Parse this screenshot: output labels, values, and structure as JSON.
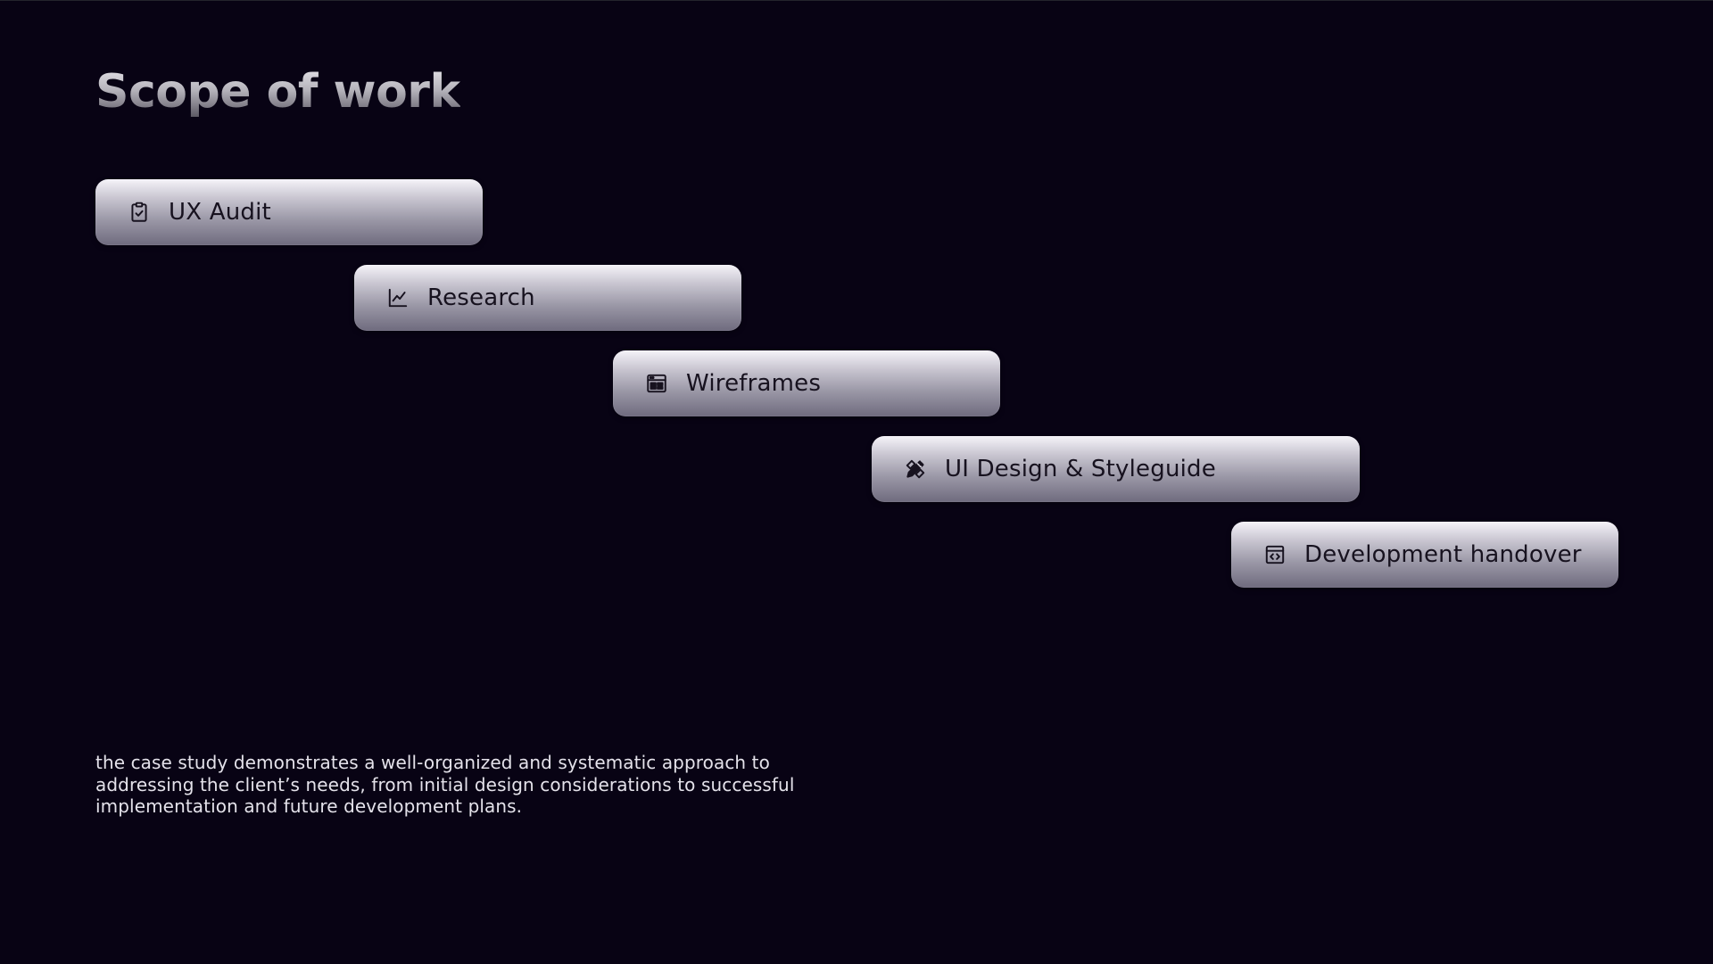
{
  "page": {
    "title": "Scope of work",
    "description": "the case study demonstrates a well-organized and systematic approach to addressing the client’s needs, from initial design considerations to successful implementation and future development plans."
  },
  "steps": [
    {
      "label": "UX Audit",
      "icon": "clipboard-check-icon"
    },
    {
      "label": "Research",
      "icon": "line-chart-icon"
    },
    {
      "label": "Wireframes",
      "icon": "layout-window-icon"
    },
    {
      "label": "UI Design & Styleguide",
      "icon": "pencil-ruler-icon"
    },
    {
      "label": "Development handover",
      "icon": "code-window-icon"
    }
  ],
  "colors": {
    "background": "#080314",
    "title_top": "#e9e8ec",
    "title_bottom": "#57545f",
    "pill_top": "#f5f3f9",
    "pill_bottom": "#6f6b7e",
    "pill_text": "#17121f",
    "body_text": "#e4e2ea"
  }
}
